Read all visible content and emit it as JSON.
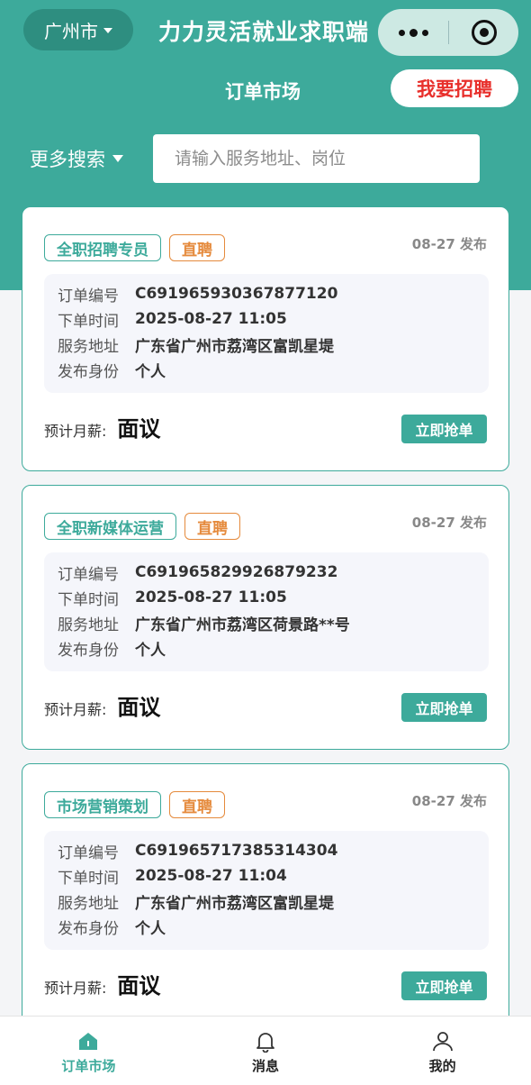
{
  "header": {
    "city": "广州市",
    "app_title": "力力灵活就业求职端",
    "page_title": "订单市场",
    "hire_label": "我要招聘",
    "more_search": "更多搜索",
    "search_placeholder": "请输入服务地址、岗位"
  },
  "orders": [
    {
      "title": "全职招聘专员",
      "type": "直聘",
      "published": "08-27 发布",
      "rows": [
        {
          "label": "订单编号",
          "value": "C691965930367877120"
        },
        {
          "label": "下单时间",
          "value": "2025-08-27 11:05"
        },
        {
          "label": "服务地址",
          "value": "广东省广州市荔湾区富凯星堤"
        },
        {
          "label": "发布身份",
          "value": "个人"
        }
      ],
      "salary_label": "预计月薪:",
      "salary": "面议",
      "action": "立即抢单"
    },
    {
      "title": "全职新媒体运营",
      "type": "直聘",
      "published": "08-27 发布",
      "rows": [
        {
          "label": "订单编号",
          "value": "C691965829926879232"
        },
        {
          "label": "下单时间",
          "value": "2025-08-27 11:05"
        },
        {
          "label": "服务地址",
          "value": "广东省广州市荔湾区荷景路**号"
        },
        {
          "label": "发布身份",
          "value": "个人"
        }
      ],
      "salary_label": "预计月薪:",
      "salary": "面议",
      "action": "立即抢单"
    },
    {
      "title": "市场营销策划",
      "type": "直聘",
      "published": "08-27 发布",
      "rows": [
        {
          "label": "订单编号",
          "value": "C691965717385314304"
        },
        {
          "label": "下单时间",
          "value": "2025-08-27 11:04"
        },
        {
          "label": "服务地址",
          "value": "广东省广州市荔湾区富凯星堤"
        },
        {
          "label": "发布身份",
          "value": "个人"
        }
      ],
      "salary_label": "预计月薪:",
      "salary": "面议",
      "action": "立即抢单"
    }
  ],
  "tabbar": {
    "tabs": [
      {
        "label": "订单市场",
        "icon": "home-icon",
        "active": true
      },
      {
        "label": "消息",
        "icon": "bell-icon",
        "active": false
      },
      {
        "label": "我的",
        "icon": "user-icon",
        "active": false
      }
    ]
  },
  "colors": {
    "primary": "#3daa9b",
    "hire_text": "#e8302c",
    "tag_orange": "#e58a3c"
  }
}
